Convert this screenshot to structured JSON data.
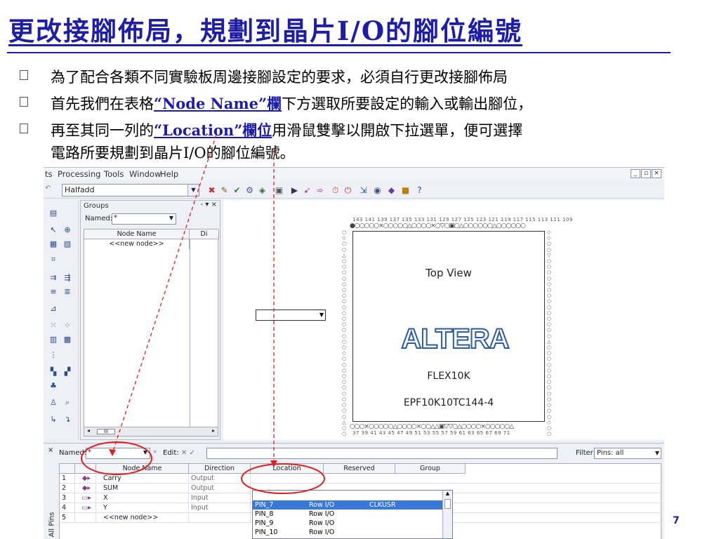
{
  "slide": {
    "title": "更改接腳佈局，規劃到晶片I/O的腳位編號",
    "bullets": [
      {
        "pre": "為了配合各類不同實驗板周邊接腳設定的要求，必須自行更改接腳佈局",
        "hl": "",
        "post": ""
      },
      {
        "pre": "首先我們在表格",
        "hl": "“Node Name”欄",
        "post": "下方選取所要設定的輸入或輸出腳位，"
      },
      {
        "pre": "再至其同一列的",
        "hl": "“Location”欄位",
        "post": "用滑鼠雙擊以開啟下拉選單，便可選擇"
      },
      {
        "pre": "電路所要規劃到晶片I/O的腳位編號。",
        "hl": "",
        "post": ""
      }
    ],
    "page_number": "7"
  },
  "app": {
    "menu": [
      "ts",
      "Processing",
      "Tools",
      "Window",
      "Help"
    ],
    "window_controls": [
      "_",
      "▫",
      "×"
    ],
    "project_combo": "Halfadd",
    "groups_panel": {
      "header": "Groups",
      "named_label": "Named:",
      "named_value": "*",
      "columns": [
        "Node Name",
        "Di"
      ],
      "new_node": "<<new node>>",
      "scroll_thumb": "III"
    },
    "chip": {
      "view_label": "Top View",
      "vendor_logo": "ALTERA",
      "family": "FLEX10K",
      "part_number": "EPF10K10TC144-4"
    },
    "pin_panel": {
      "named_label": "Named:",
      "named_value": "*",
      "edit_label": "Edit:",
      "filter_label": "Filter:",
      "filter_value": "Pins: all",
      "side_label": "All Pins",
      "columns": [
        "",
        "",
        "Node Name",
        "Direction",
        "Location",
        "Reserved",
        "Group"
      ],
      "rows": [
        {
          "num": "1",
          "icon": "output-pin-icon",
          "name": "Carry",
          "direction": "Output"
        },
        {
          "num": "2",
          "icon": "output-pin-icon",
          "name": "SUM",
          "direction": "Output"
        },
        {
          "num": "3",
          "icon": "input-pin-icon",
          "name": "X",
          "direction": "Input"
        },
        {
          "num": "4",
          "icon": "input-pin-icon",
          "name": "Y",
          "direction": "Input"
        },
        {
          "num": "5",
          "icon": "",
          "name": "<<new node>>",
          "direction": ""
        }
      ],
      "location_dropdown": [
        {
          "pin": "PIN_7",
          "type": "Row I/O",
          "extra": "CLKUSR",
          "selected": true
        },
        {
          "pin": "PIN_8",
          "type": "Row I/O",
          "extra": "",
          "selected": false
        },
        {
          "pin": "PIN_9",
          "type": "Row I/O",
          "extra": "",
          "selected": false
        },
        {
          "pin": "PIN_10",
          "type": "Row I/O",
          "extra": "",
          "selected": false
        }
      ]
    }
  },
  "annotation_color": "#e02020",
  "title_color": "#1d1da8"
}
